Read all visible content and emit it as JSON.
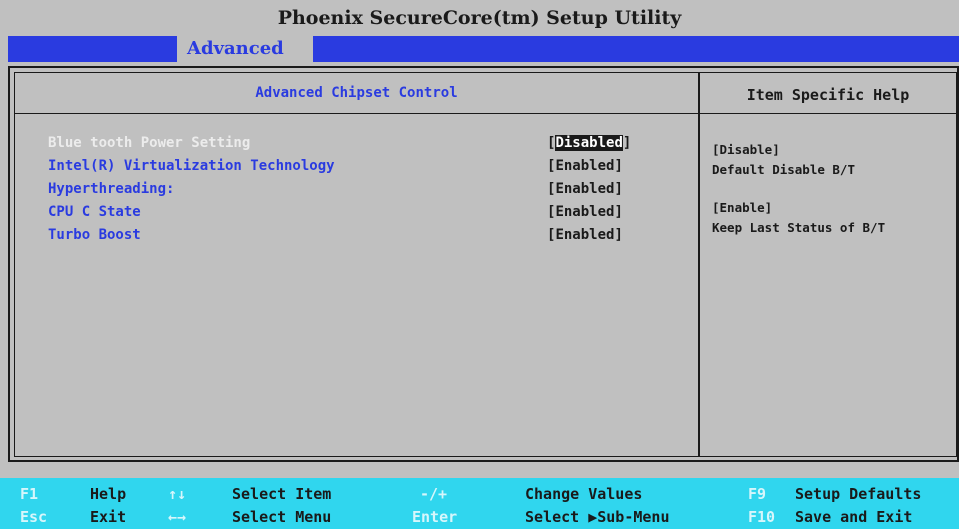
{
  "window": {
    "title": "Phoenix SecureCore(tm) Setup Utility"
  },
  "menu": {
    "active_tab": "Advanced"
  },
  "main": {
    "section_title": "Advanced Chipset Control",
    "items": [
      {
        "label": "Blue tooth Power Setting",
        "value": "Disabled",
        "selected": true
      },
      {
        "label": "Intel(R) Virtualization Technology",
        "value": "Enabled"
      },
      {
        "label": "Hyperthreading:",
        "value": "Enabled"
      },
      {
        "label": "CPU C State",
        "value": "Enabled"
      },
      {
        "label": "Turbo Boost",
        "value": "Enabled"
      }
    ]
  },
  "help": {
    "title": "Item Specific Help",
    "lines": [
      "[Disable]",
      "Default Disable B/T",
      "[Enable]",
      "Keep Last Status of B/T"
    ]
  },
  "footer": {
    "row1": [
      {
        "key": "F1",
        "label": "Help"
      },
      {
        "key": "↑↓",
        "label": "Select Item"
      },
      {
        "key": "-/+",
        "label": "Change Values"
      },
      {
        "key": "F9",
        "label": "Setup Defaults"
      }
    ],
    "row2": [
      {
        "key": "Esc",
        "label": "Exit"
      },
      {
        "key": "←→",
        "label": "Select Menu"
      },
      {
        "key": "Enter",
        "label": "Select ▶Sub-Menu"
      },
      {
        "key": "F10",
        "label": "Save and Exit"
      }
    ]
  },
  "colors": {
    "background": "#c0c0c0",
    "accent_blue": "#2a3be0",
    "footer_cyan": "#30d6ee",
    "text_dark": "#1a1a1a"
  }
}
